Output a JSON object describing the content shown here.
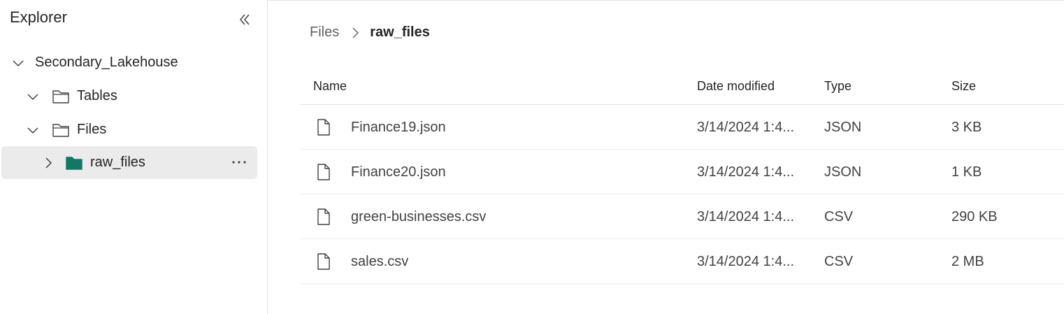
{
  "sidebar": {
    "title": "Explorer",
    "tree": {
      "root": "Secondary_Lakehouse",
      "tables": "Tables",
      "files": "Files",
      "raw_files": "raw_files"
    }
  },
  "breadcrumb": {
    "parent": "Files",
    "current": "raw_files"
  },
  "table": {
    "headers": {
      "name": "Name",
      "date": "Date modified",
      "type": "Type",
      "size": "Size"
    },
    "rows": [
      {
        "name": "Finance19.json",
        "date": "3/14/2024 1:4...",
        "type": "JSON",
        "size": "3 KB"
      },
      {
        "name": "Finance20.json",
        "date": "3/14/2024 1:4...",
        "type": "JSON",
        "size": "1 KB"
      },
      {
        "name": "green-businesses.csv",
        "date": "3/14/2024 1:4...",
        "type": "CSV",
        "size": "290 KB"
      },
      {
        "name": "sales.csv",
        "date": "3/14/2024 1:4...",
        "type": "CSV",
        "size": "2 MB"
      }
    ]
  },
  "colors": {
    "accent_folder": "#117865",
    "selected_bg": "#ebebeb"
  }
}
